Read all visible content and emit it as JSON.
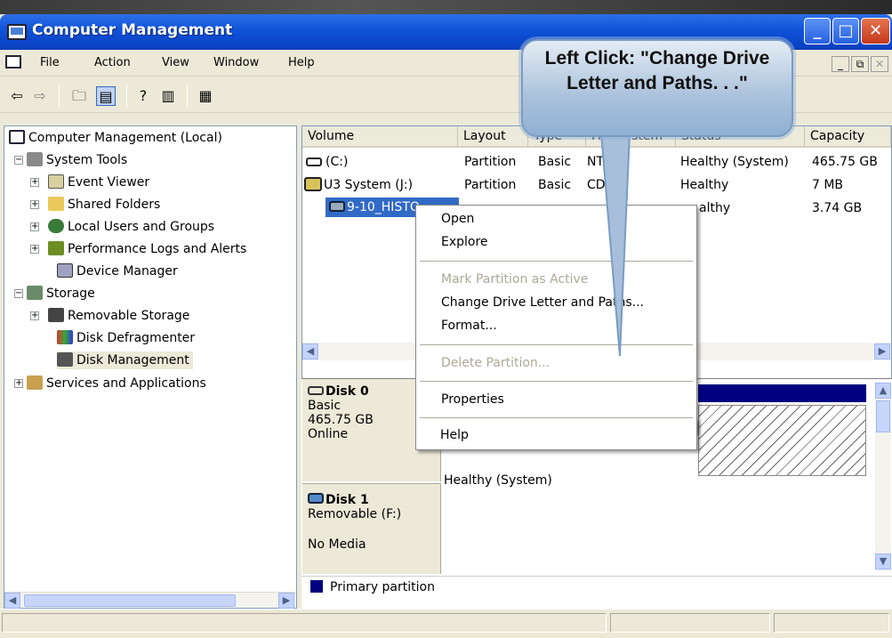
{
  "window": {
    "title": "Computer Management"
  },
  "menubar": {
    "items": [
      "File",
      "Action",
      "View",
      "Window",
      "Help"
    ]
  },
  "tree": {
    "root": "Computer Management (Local)",
    "system_tools": "System Tools",
    "event_viewer": "Event Viewer",
    "shared_folders": "Shared Folders",
    "local_users": "Local Users and Groups",
    "perf_logs": "Performance Logs and Alerts",
    "device_manager": "Device Manager",
    "storage": "Storage",
    "removable_storage": "Removable Storage",
    "disk_defrag": "Disk Defragmenter",
    "disk_management": "Disk Management",
    "services": "Services and Applications"
  },
  "columns": [
    "Volume",
    "Layout",
    "Type",
    "File System",
    "Status",
    "Capacity"
  ],
  "columns_visible": {
    "type": "Type",
    "fs": "File System",
    "status": "Status"
  },
  "volumes": [
    {
      "volume": "(C:)",
      "layout": "Partition",
      "type": "Basic",
      "fs": "NTFS",
      "status": "Healthy (System)",
      "capacity": "465.75 GB"
    },
    {
      "volume": "U3 System (J:)",
      "layout": "Partition",
      "type": "Basic",
      "fs": "CDFS",
      "status": "Healthy",
      "capacity": "7 MB"
    },
    {
      "volume": "9-10_HISTORY (I:)",
      "layout": "",
      "type": "",
      "fs": "",
      "status": "Healthy",
      "capacity": "3.74 GB"
    }
  ],
  "visible_fragments": {
    "row3_volume": "9-10_HISTO",
    "row3_status": "althy"
  },
  "disks": [
    {
      "name": "Disk 0",
      "type": "Basic",
      "size": "465.75 GB",
      "state": "Online",
      "partition_status": "Healthy (System)"
    },
    {
      "name": "Disk 1",
      "type": "Removable (F:)",
      "state": "No Media"
    }
  ],
  "legend": {
    "primary": "Primary partition",
    "color": "#000080"
  },
  "context_menu": {
    "open": "Open",
    "explore": "Explore",
    "mark_active": "Mark Partition as Active",
    "change_letter": "Change Drive Letter and Paths...",
    "format": "Format...",
    "delete": "Delete Partition...",
    "properties": "Properties",
    "help": "Help"
  },
  "callout": {
    "text": "Left Click: \"Change Drive Letter and Paths. . .\""
  },
  "colors": {
    "titlebar": "#0a44c8",
    "selection": "#316ac5",
    "callout": "#a9c1db"
  }
}
